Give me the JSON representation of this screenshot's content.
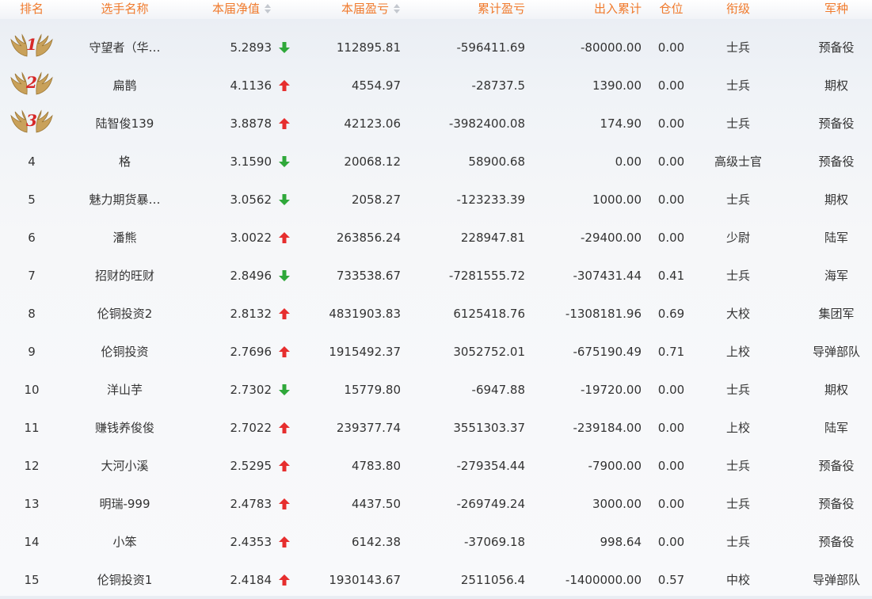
{
  "colors": {
    "header_text": "#f07a2c",
    "up": "#e62e2e",
    "down": "#2fa83a",
    "badge_number": "#d62828",
    "wing": "#c9a15a"
  },
  "header": {
    "rank": "排名",
    "name": "选手名称",
    "nav": "本届净值",
    "profit": "本届盈亏",
    "cumulative": "累计盈亏",
    "flow": "出入累计",
    "position": "仓位",
    "title": "衔级",
    "branch": "军种"
  },
  "rows": [
    {
      "rank": "1",
      "name": "守望者（华…",
      "nav": "5.2893",
      "trend": "down",
      "profit": "112895.81",
      "cumulative": "-596411.69",
      "flow": "-80000.00",
      "position": "0.00",
      "title": "士兵",
      "branch": "预备役"
    },
    {
      "rank": "2",
      "name": "扁鹊",
      "nav": "4.1136",
      "trend": "up",
      "profit": "4554.97",
      "cumulative": "-28737.5",
      "flow": "1390.00",
      "position": "0.00",
      "title": "士兵",
      "branch": "期权"
    },
    {
      "rank": "3",
      "name": "陆智俊139",
      "nav": "3.8878",
      "trend": "up",
      "profit": "42123.06",
      "cumulative": "-3982400.08",
      "flow": "174.90",
      "position": "0.00",
      "title": "士兵",
      "branch": "预备役"
    },
    {
      "rank": "4",
      "name": "格",
      "nav": "3.1590",
      "trend": "down",
      "profit": "20068.12",
      "cumulative": "58900.68",
      "flow": "0.00",
      "position": "0.00",
      "title": "高级士官",
      "branch": "预备役"
    },
    {
      "rank": "5",
      "name": "魅力期货暴…",
      "nav": "3.0562",
      "trend": "down",
      "profit": "2058.27",
      "cumulative": "-123233.39",
      "flow": "1000.00",
      "position": "0.00",
      "title": "士兵",
      "branch": "期权"
    },
    {
      "rank": "6",
      "name": "潘熊",
      "nav": "3.0022",
      "trend": "up",
      "profit": "263856.24",
      "cumulative": "228947.81",
      "flow": "-29400.00",
      "position": "0.00",
      "title": "少尉",
      "branch": "陆军"
    },
    {
      "rank": "7",
      "name": "招财的旺财",
      "nav": "2.8496",
      "trend": "down",
      "profit": "733538.67",
      "cumulative": "-7281555.72",
      "flow": "-307431.44",
      "position": "0.41",
      "title": "士兵",
      "branch": "海军"
    },
    {
      "rank": "8",
      "name": "伦铜投资2",
      "nav": "2.8132",
      "trend": "up",
      "profit": "4831903.83",
      "cumulative": "6125418.76",
      "flow": "-1308181.96",
      "position": "0.69",
      "title": "大校",
      "branch": "集团军"
    },
    {
      "rank": "9",
      "name": "伦铜投资",
      "nav": "2.7696",
      "trend": "up",
      "profit": "1915492.37",
      "cumulative": "3052752.01",
      "flow": "-675190.49",
      "position": "0.71",
      "title": "上校",
      "branch": "导弹部队"
    },
    {
      "rank": "10",
      "name": "洋山芋",
      "nav": "2.7302",
      "trend": "down",
      "profit": "15779.80",
      "cumulative": "-6947.88",
      "flow": "-19720.00",
      "position": "0.00",
      "title": "士兵",
      "branch": "期权"
    },
    {
      "rank": "11",
      "name": "赚钱养俊俊",
      "nav": "2.7022",
      "trend": "up",
      "profit": "239377.74",
      "cumulative": "3551303.37",
      "flow": "-239184.00",
      "position": "0.00",
      "title": "上校",
      "branch": "陆军"
    },
    {
      "rank": "12",
      "name": "大河小溪",
      "nav": "2.5295",
      "trend": "up",
      "profit": "4783.80",
      "cumulative": "-279354.44",
      "flow": "-7900.00",
      "position": "0.00",
      "title": "士兵",
      "branch": "预备役"
    },
    {
      "rank": "13",
      "name": "明瑞-999",
      "nav": "2.4783",
      "trend": "up",
      "profit": "4437.50",
      "cumulative": "-269749.24",
      "flow": "3000.00",
      "position": "0.00",
      "title": "士兵",
      "branch": "预备役"
    },
    {
      "rank": "14",
      "name": "小笨",
      "nav": "2.4353",
      "trend": "up",
      "profit": "6142.38",
      "cumulative": "-37069.18",
      "flow": "998.64",
      "position": "0.00",
      "title": "士兵",
      "branch": "预备役"
    },
    {
      "rank": "15",
      "name": "伦铜投资1",
      "nav": "2.4184",
      "trend": "up",
      "profit": "1930143.67",
      "cumulative": "2511056.4",
      "flow": "-1400000.00",
      "position": "0.57",
      "title": "中校",
      "branch": "导弹部队"
    }
  ]
}
